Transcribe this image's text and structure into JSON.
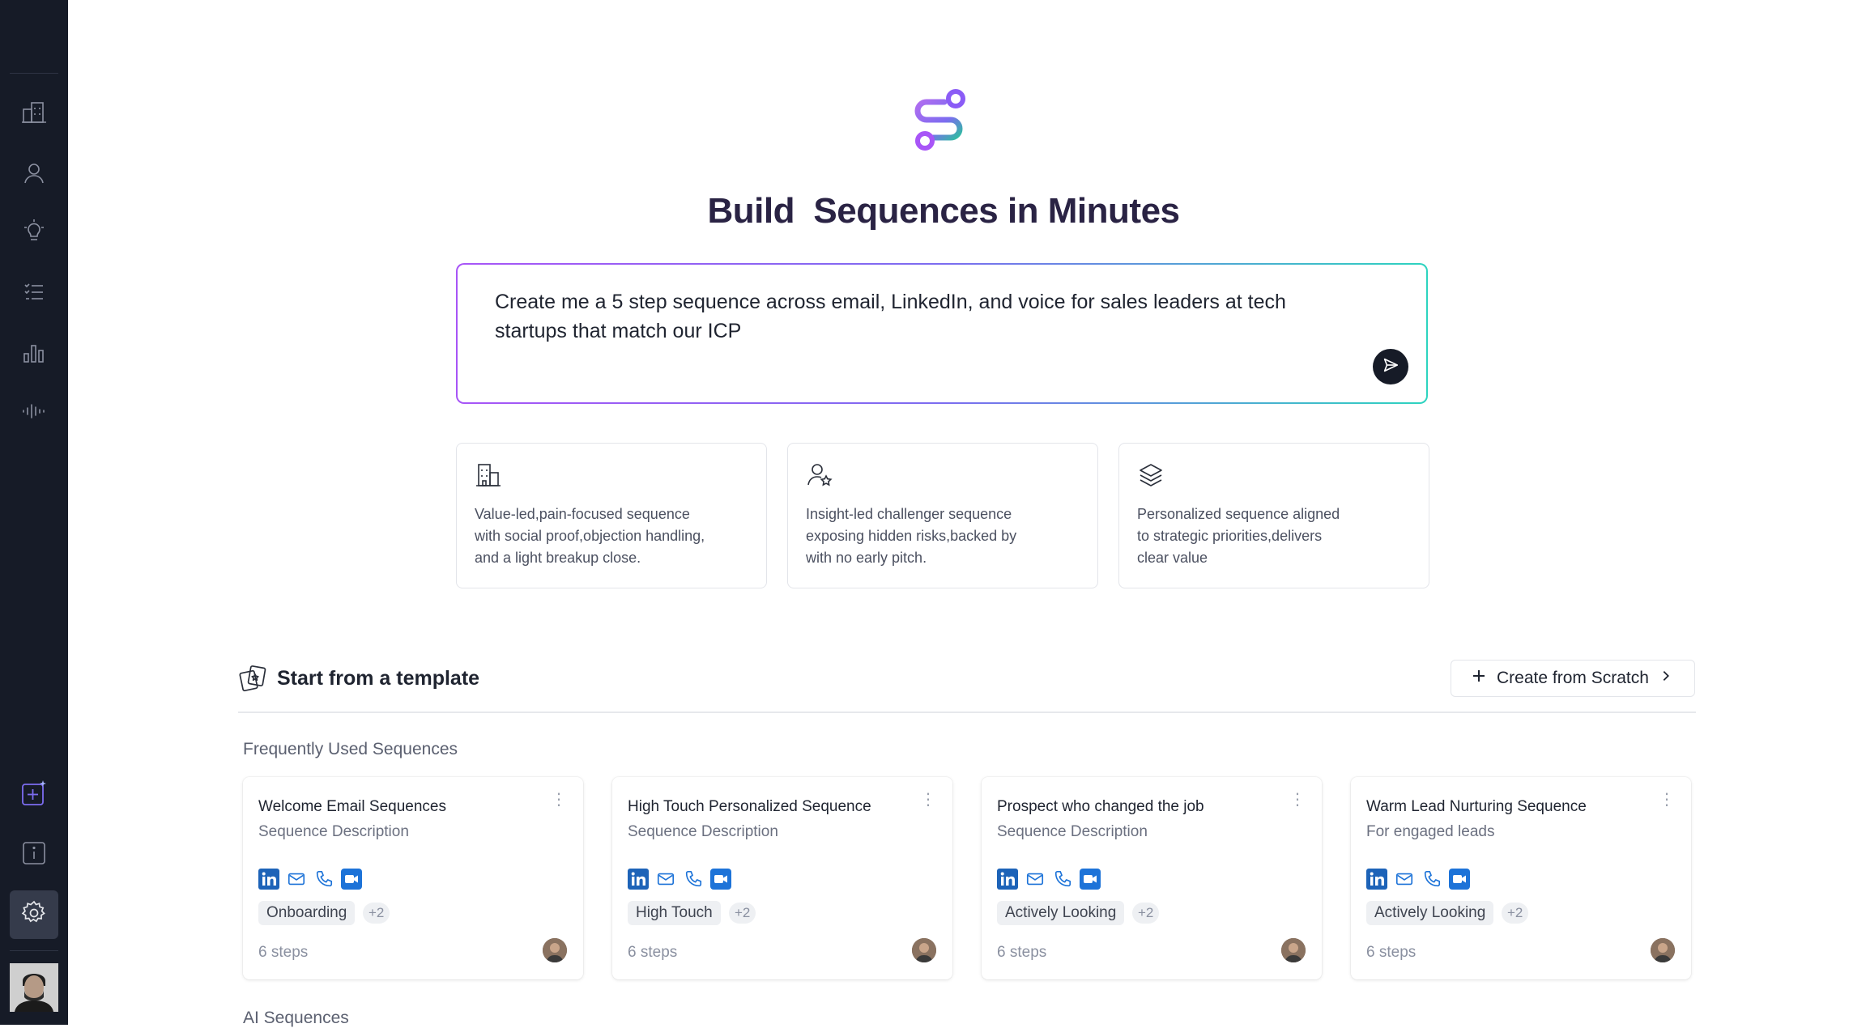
{
  "sidebar": {
    "items": [
      {
        "name": "company-icon"
      },
      {
        "name": "person-icon"
      },
      {
        "name": "lightbulb-icon"
      },
      {
        "name": "checklist-icon"
      },
      {
        "name": "bar-chart-icon"
      },
      {
        "name": "waveform-icon"
      },
      {
        "name": "add-sparkle-icon"
      },
      {
        "name": "info-icon"
      },
      {
        "name": "gear-icon"
      }
    ]
  },
  "hero": {
    "title": "Build  Sequences in Minutes",
    "prompt": "Create me a 5 step sequence across email, LinkedIn, and voice for sales leaders at tech startups that match our ICP"
  },
  "suggestions": [
    {
      "icon": "building-icon",
      "text": "Value-led,pain-focused sequence\nwith social proof,objection handling,\nand a light breakup close."
    },
    {
      "icon": "user-star-icon",
      "text": "Insight-led challenger sequence\n exposing hidden risks,backed by\nwith no early pitch."
    },
    {
      "icon": "layers-icon",
      "text": "Personalized sequence aligned\nto strategic priorities,delivers\nclear value"
    }
  ],
  "templates": {
    "title": "Start from a template",
    "create_label": "Create from Scratch",
    "frequent_label": "Frequently Used Sequences",
    "ai_label": "AI Sequences",
    "cards": [
      {
        "title": "Welcome Email Sequences",
        "desc": "Sequence Description",
        "tag": "Onboarding",
        "more": "+2",
        "steps": "6 steps"
      },
      {
        "title": "High Touch Personalized Sequence",
        "desc": "Sequence Description",
        "tag": "High Touch",
        "more": "+2",
        "steps": "6 steps"
      },
      {
        "title": "Prospect who changed the job",
        "desc": "Sequence Description",
        "tag": "Actively Looking",
        "more": "+2",
        "steps": "6 steps"
      },
      {
        "title": "Warm Lead Nurturing Sequence",
        "desc": "For engaged leads",
        "tag": "Actively Looking",
        "more": "+2",
        "steps": "6 steps"
      }
    ]
  },
  "colors": {
    "sidebar": "#161b27",
    "title": "#2a2344",
    "accent_purple": "#a855f7",
    "accent_teal": "#2dd4bf",
    "channel_blue": "#1d73d8"
  }
}
